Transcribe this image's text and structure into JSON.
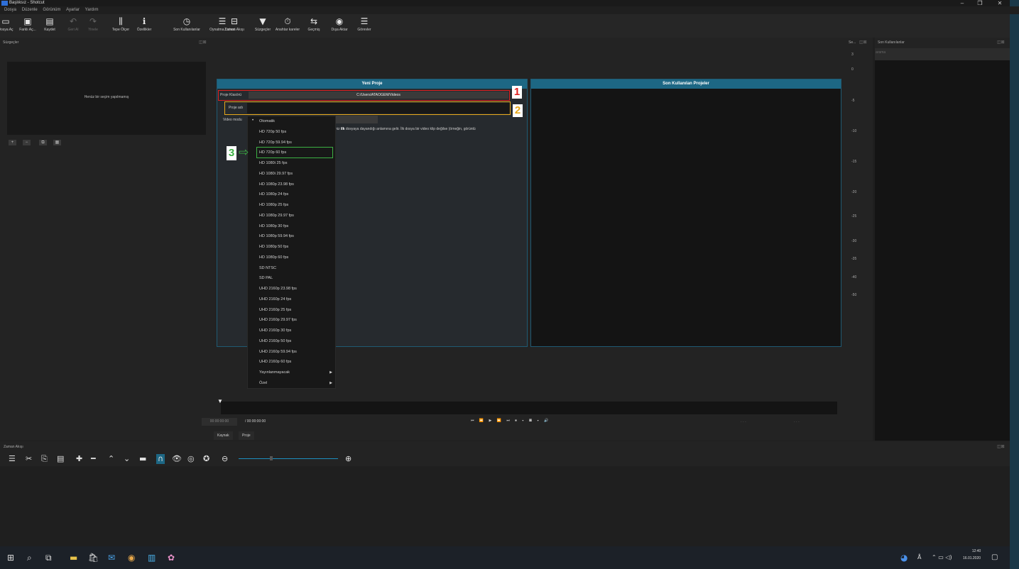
{
  "window": {
    "title": "Başlıksız - Shotcut",
    "minimize": "–",
    "restore": "❐",
    "close": "✕"
  },
  "menu": [
    "Dosya",
    "Düzenle",
    "Görünüm",
    "Ayarlar",
    "Yardım"
  ],
  "toolbar": [
    {
      "label": "Dosya Aç",
      "icon": "folder-open-icon",
      "glyph": "▭"
    },
    {
      "label": "Farklı Aç...",
      "icon": "open-other-icon",
      "glyph": "▣"
    },
    {
      "label": "Kaydet",
      "icon": "save-icon",
      "glyph": "▤"
    },
    {
      "label": "Geri Al",
      "icon": "undo-icon",
      "glyph": "↶",
      "disabled": true
    },
    {
      "label": "Yinele",
      "icon": "redo-icon",
      "glyph": "↷",
      "disabled": true
    },
    {
      "label": "Tepe Ölçer",
      "icon": "peak-meter-icon",
      "glyph": "⫼"
    },
    {
      "label": "Özellikler",
      "icon": "properties-icon",
      "glyph": "ℹ"
    },
    {
      "label": "Son Kullanılanlar",
      "icon": "recent-icon",
      "glyph": "◷"
    },
    {
      "label": "Oynatma Listesi",
      "icon": "playlist-icon",
      "glyph": "☰"
    },
    {
      "label": "Zaman Akışı",
      "icon": "timeline-icon",
      "glyph": "⊟"
    },
    {
      "label": "Süzgeçler",
      "icon": "filter-icon",
      "glyph": "▼"
    },
    {
      "label": "Anahtar kareler",
      "icon": "keyframes-icon",
      "glyph": "⏱"
    },
    {
      "label": "Geçmiş",
      "icon": "history-icon",
      "glyph": "⇆"
    },
    {
      "label": "Dışa Aktar",
      "icon": "export-icon",
      "glyph": "◉"
    },
    {
      "label": "Görevler",
      "icon": "jobs-icon",
      "glyph": "☰"
    }
  ],
  "filters_panel": {
    "title": "Süzgeçler",
    "empty_text": "Henüz bir seçim yapılmamış",
    "buttons": [
      "+",
      "−",
      "⧉",
      "▦"
    ]
  },
  "new_project": {
    "header": "Yeni Proje",
    "folder_label": "Proje Klasörü",
    "folder_value": "C:/Users/ATAOGEM/Videos",
    "name_label": "Proje adı",
    "video_mode_label": "Video modu",
    "description_pre": "kledğiniz",
    "description_bold": "ilk",
    "description_post": "dosyaya dayandığı anlamına gelir. İlk dosya bir video klip değilse (örneğin, görüntü",
    "markers": [
      "1",
      "2",
      "3"
    ]
  },
  "recent_projects": {
    "header": "Son Kullanılan Projeler"
  },
  "video_modes": [
    {
      "label": "Otomatik",
      "selected": true
    },
    {
      "label": "HD 720p 50 fps"
    },
    {
      "label": "HD 720p 59.94 fps"
    },
    {
      "label": "HD 720p 60 fps",
      "highlighted": true
    },
    {
      "label": "HD 1080i 25 fps"
    },
    {
      "label": "HD 1080i 29.97 fps"
    },
    {
      "label": "HD 1080p 23.98 fps"
    },
    {
      "label": "HD 1080p 24 fps"
    },
    {
      "label": "HD 1080p 25 fps"
    },
    {
      "label": "HD 1080p 29.97 fps"
    },
    {
      "label": "HD 1080p 30 fps"
    },
    {
      "label": "HD 1080p 59.94 fps"
    },
    {
      "label": "HD 1080p 50 fps"
    },
    {
      "label": "HD 1080p 60 fps"
    },
    {
      "label": "SD NTSC"
    },
    {
      "label": "SD PAL"
    },
    {
      "label": "UHD 2160p 23.98 fps"
    },
    {
      "label": "UHD 2160p 24 fps"
    },
    {
      "label": "UHD 2160p 25 fps"
    },
    {
      "label": "UHD 2160p 29.97 fps"
    },
    {
      "label": "UHD 2160p 30 fps"
    },
    {
      "label": "UHD 2160p 50 fps"
    },
    {
      "label": "UHD 2160p 59.94 fps"
    },
    {
      "label": "UHD 2160p 60 fps"
    },
    {
      "label": "Yayınlanmayacak",
      "submenu": true
    },
    {
      "label": "Özel",
      "submenu": true
    }
  ],
  "player": {
    "timecode": "00:00:00:00",
    "duration": "/ 00:00:00:00",
    "transport": "⏮ ⏪ ▶ ⏩ ⏭ ⏹ ▾ ▦ ▾ 🔊",
    "tabs": [
      "Kaynak",
      "Proje"
    ],
    "dots1": "· · ·",
    "dots2": "· · ·"
  },
  "meter": {
    "title": "Se...",
    "ticks": [
      "3",
      "0",
      "-5",
      "-10",
      "-15",
      "-20",
      "-25",
      "-30",
      "-35",
      "-40",
      "-50"
    ]
  },
  "recent_panel": {
    "title": "Son Kullanılanlar",
    "search_placeholder": "arama"
  },
  "timeline": {
    "title": "Zaman Akışı",
    "tools": [
      {
        "glyph": "☰",
        "icon": "menu-icon"
      },
      {
        "glyph": "✂",
        "icon": "cut-icon"
      },
      {
        "glyph": "⎘",
        "icon": "copy-icon"
      },
      {
        "glyph": "▤",
        "icon": "paste-icon"
      },
      {
        "glyph": "✚",
        "icon": "append-icon"
      },
      {
        "glyph": "━",
        "icon": "remove-icon"
      },
      {
        "glyph": "⌃",
        "icon": "lift-icon"
      },
      {
        "glyph": "⌄",
        "icon": "overwrite-icon"
      },
      {
        "glyph": "▬",
        "icon": "split-icon"
      },
      {
        "glyph": "∩",
        "icon": "snap-icon"
      },
      {
        "glyph": "👁",
        "icon": "scrub-icon"
      },
      {
        "glyph": "◎",
        "icon": "ripple-icon"
      },
      {
        "glyph": "✪",
        "icon": "ripple-all-icon"
      },
      {
        "glyph": "⊖",
        "icon": "zoom-out-icon"
      },
      {
        "glyph": "⊕",
        "icon": "zoom-in-icon"
      }
    ]
  },
  "taskbar": {
    "time": "12:40",
    "date": "16.01.2020"
  }
}
